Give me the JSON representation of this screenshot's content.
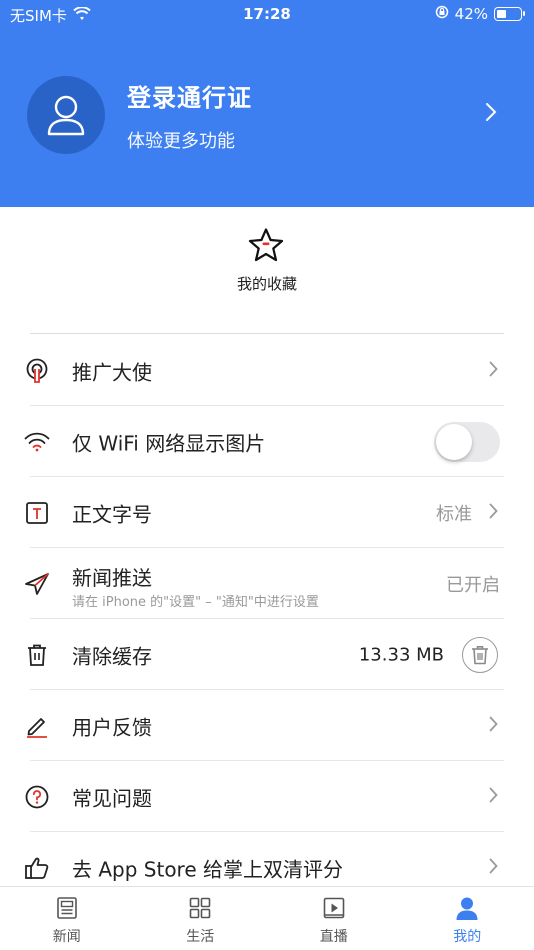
{
  "status_bar": {
    "carrier": "无SIM卡",
    "time": "17:28",
    "battery_percent": "42%",
    "battery_level": 0.42
  },
  "profile": {
    "title": "登录通行证",
    "subtitle": "体验更多功能"
  },
  "favorites": {
    "label": "我的收藏"
  },
  "settings": [
    {
      "label": "推广大使",
      "icon": "ambassador-icon"
    },
    {
      "label": "仅 WiFi 网络显示图片",
      "icon": "wifi-icon",
      "toggle_on": false
    },
    {
      "label": "正文字号",
      "icon": "font-size-icon",
      "value": "标准"
    },
    {
      "label": "新闻推送",
      "icon": "paper-plane-icon",
      "hint": "请在 iPhone 的\"设置\" – \"通知\"中进行设置",
      "value": "已开启"
    },
    {
      "label": "清除缓存",
      "icon": "trash-icon",
      "value": "13.33 MB"
    },
    {
      "label": "用户反馈",
      "icon": "pencil-icon"
    },
    {
      "label": "常见问题",
      "icon": "question-icon"
    },
    {
      "label": "去 App Store 给掌上双清评分",
      "icon": "thumbs-up-icon"
    }
  ],
  "tabs": [
    {
      "label": "新闻",
      "icon": "news-icon",
      "active": false
    },
    {
      "label": "生活",
      "icon": "grid-icon",
      "active": false
    },
    {
      "label": "直播",
      "icon": "play-icon",
      "active": false
    },
    {
      "label": "我的",
      "icon": "user-icon",
      "active": true
    }
  ],
  "colors": {
    "brand_blue": "#3d7ff0",
    "accent_red": "#e0352b",
    "muted_gray": "#999999"
  }
}
